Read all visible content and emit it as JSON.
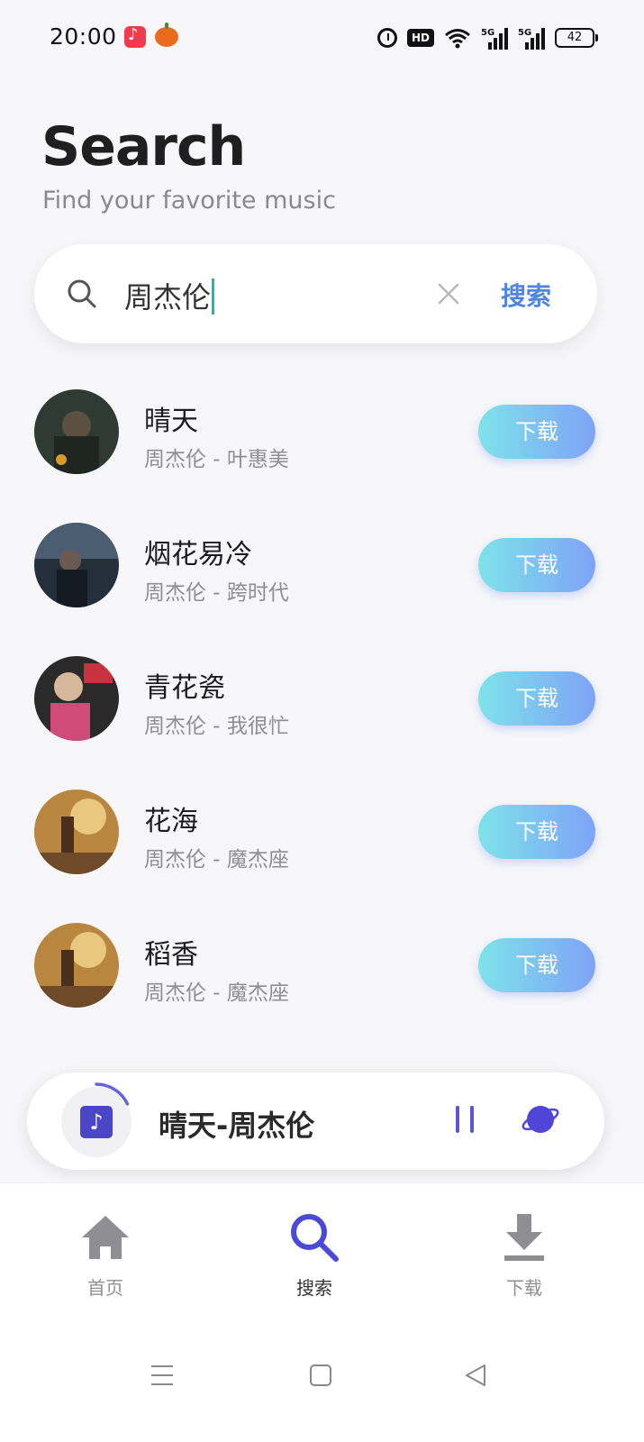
{
  "status_bar": {
    "time": "20:00",
    "hd_label": "HD",
    "battery_level": "42",
    "icons": [
      "music-app-icon",
      "pumpkin-app-icon",
      "alarm-icon",
      "hd-voice-icon",
      "wifi-icon",
      "5g-signal-icon",
      "5g-signal-icon",
      "battery-icon"
    ]
  },
  "header": {
    "title": "Search",
    "subtitle": "Find your favorite music"
  },
  "search": {
    "value": "周杰伦",
    "search_button": "搜索",
    "icons": [
      "search-icon",
      "clear-icon"
    ]
  },
  "songs": [
    {
      "title": "晴天",
      "subtitle": "周杰伦 - 叶惠美",
      "button": "下载",
      "cover_color": "#3a4a3a"
    },
    {
      "title": "烟花易冷",
      "subtitle": "周杰伦 - 跨时代",
      "button": "下载",
      "cover_color": "#2a3a4a"
    },
    {
      "title": "青花瓷",
      "subtitle": "周杰伦 - 我很忙",
      "button": "下载",
      "cover_color": "#b04a5a"
    },
    {
      "title": "花海",
      "subtitle": "周杰伦 - 魔杰座",
      "button": "下载",
      "cover_color": "#a87a3a"
    },
    {
      "title": "稻香",
      "subtitle": "周杰伦 - 魔杰座",
      "button": "下载",
      "cover_color": "#a87a3a"
    }
  ],
  "player": {
    "title": "晴天-周杰伦",
    "progress": 0.18,
    "icons": [
      "music-note-icon",
      "pause-icon",
      "planet-icon"
    ],
    "accent": "#5a54d8"
  },
  "bottom_nav": {
    "items": [
      {
        "label": "首页",
        "icon": "home-icon",
        "active": false
      },
      {
        "label": "搜索",
        "icon": "search-icon",
        "active": true
      },
      {
        "label": "下载",
        "icon": "download-icon",
        "active": false
      }
    ]
  },
  "system_nav": {
    "icons": [
      "menu-icon",
      "home-square-icon",
      "back-triangle-icon"
    ]
  },
  "colors": {
    "accent_blue": "#4e86e0",
    "nav_active": "#4a4ad8",
    "nav_inactive": "#8e8e93",
    "button_gradient_start": "#7ee3ea",
    "button_gradient_end": "#7fa2f6"
  }
}
